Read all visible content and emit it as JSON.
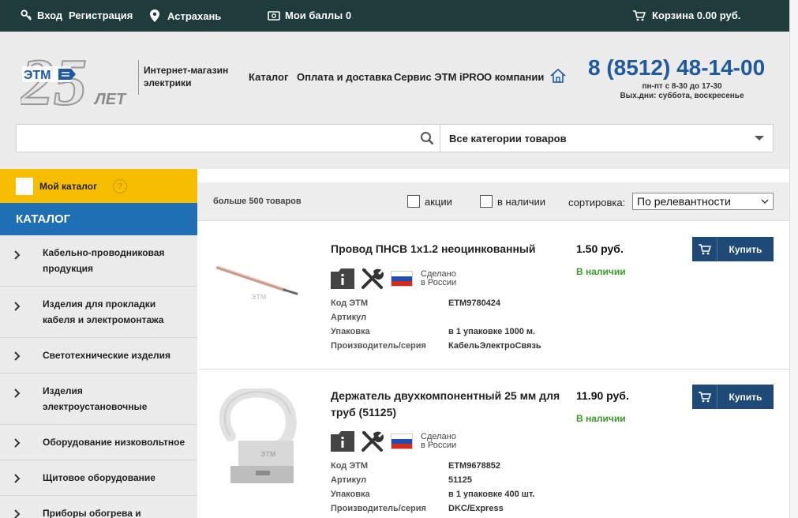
{
  "topbar": {
    "login": "Вход",
    "register": "Регистрация",
    "city": "Астрахань",
    "points": "Мои баллы 0",
    "cart": "Корзина 0.00 руб."
  },
  "header": {
    "logo_text": "ЭТМ",
    "logo_years": "25",
    "logo_suffix": "ЛЕТ",
    "tagline": "Интернет-магазин электрики",
    "nav": [
      "Каталог",
      "Оплата и доставка",
      "Сервис ЭТМ iPRO",
      "О компании"
    ],
    "phone": "8 (8512) 48-14-00",
    "hours": "пн-пт с 8-30 до 17-30",
    "weekend": "Вых.дни: суббота, воскресенье"
  },
  "search": {
    "placeholder": "",
    "category": "Все категории товаров"
  },
  "sidebar": {
    "my_catalog": "Мой каталог",
    "help": "?",
    "catalog_title": "КАТАЛОГ",
    "items": [
      "Кабельно-проводниковая продукция",
      "Изделия для прокладки кабеля и электромонтажа",
      "Светотехнические изделия",
      "Изделия электроустановочные",
      "Оборудование низковольтное",
      "Щитовое оборудование",
      "Приборы обогрева и"
    ]
  },
  "filters": {
    "count": "больше 500 товаров",
    "promo": "акции",
    "in_stock": "в наличии",
    "sort_label": "сортировка:",
    "sort_value": "По релевантности"
  },
  "products": [
    {
      "name": "Провод ПНСВ 1x1.2 неоцинкованный",
      "made_line1": "Сделано",
      "made_line2": "в России",
      "props": [
        {
          "k": "Код ЭТМ",
          "v": "ETM9780424"
        },
        {
          "k": "Артикул",
          "v": ""
        },
        {
          "k": "Упаковка",
          "v": "в 1 упаковке 1000 м."
        },
        {
          "k": "Производитель/серия",
          "v": "КабельЭлектроСвязь"
        }
      ],
      "price": "1.50 руб.",
      "stock": "В наличии",
      "buy": "Купить"
    },
    {
      "name": "Держатель двухкомпонентный 25 мм для труб (51125)",
      "made_line1": "Сделано",
      "made_line2": "в России",
      "props": [
        {
          "k": "Код ЭТМ",
          "v": "ETM9678852"
        },
        {
          "k": "Артикул",
          "v": "51125"
        },
        {
          "k": "Упаковка",
          "v": "в 1 упаковке 400 шт."
        },
        {
          "k": "Производитель/серия",
          "v": "DKC/Express"
        }
      ],
      "price": "11.90 руб.",
      "stock": "В наличии",
      "buy": "Купить"
    }
  ],
  "colors": {
    "topbar": "#1f3b3b",
    "accent_blue": "#1f6fb5",
    "buy_button": "#1f4a78",
    "my_catalog": "#f7bd00",
    "in_stock": "#3b9c2a"
  }
}
